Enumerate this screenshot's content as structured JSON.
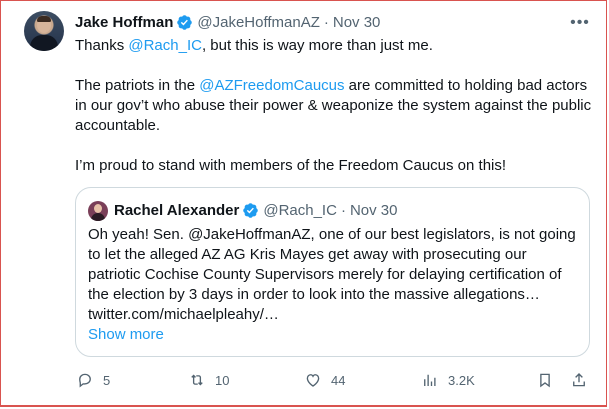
{
  "tweet": {
    "author_name": "Jake Hoffman",
    "handle": "@JakeHoffmanAZ",
    "separator": "·",
    "date": "Nov 30",
    "more_glyph": "•••",
    "line1_prefix": "Thanks ",
    "line1_mention": "@Rach_IC",
    "line1_suffix": ", but this is way more than just me.",
    "p2_prefix": "The patriots in the  ",
    "p2_mention": "@AZFreedomCaucus",
    "p2_suffix": " are committed to holding bad actors in our gov’t who abuse their power & weaponize the system against the public accountable.",
    "p3": "I’m proud to stand with members of the Freedom Caucus on this!"
  },
  "quote": {
    "author_name": "Rachel Alexander",
    "handle": "@Rach_IC",
    "separator": "·",
    "date": "Nov 30",
    "text": "Oh yeah! Sen. @JakeHoffmanAZ, one of our best legislators, is not going to let the alleged AZ AG Kris Mayes get away with prosecuting our patriotic Cochise County Supervisors merely for delaying certification of the election by 3 days in order to look into the massive allegations… twitter.com/michaelpleahy/…",
    "show_more": "Show more"
  },
  "actions": {
    "replies": "5",
    "retweets": "10",
    "likes": "44",
    "views": "3.2K"
  },
  "colors": {
    "link": "#1d9bf0",
    "secondary_text": "#536471",
    "verified": "#1d9bf0",
    "frame": "#d9534f"
  },
  "icons": [
    "verified-badge-icon",
    "more-icon",
    "reply-icon",
    "retweet-icon",
    "like-icon",
    "views-icon",
    "bookmark-icon",
    "share-icon"
  ]
}
